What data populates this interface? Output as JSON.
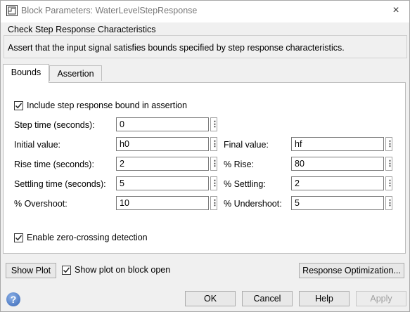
{
  "window": {
    "title": "Block Parameters: WaterLevelStepResponse"
  },
  "description": {
    "group_title": "Check Step Response Characteristics",
    "text": "Assert that the input signal satisfies bounds specified by step response characteristics."
  },
  "tabs": [
    {
      "label": "Bounds",
      "selected": true
    },
    {
      "label": "Assertion",
      "selected": false
    }
  ],
  "bounds": {
    "include_bound": {
      "label": "Include step response bound in assertion",
      "checked": true
    },
    "step_time": {
      "label": "Step time (seconds):",
      "value": "0"
    },
    "initial_value": {
      "label": "Initial value:",
      "value": "h0"
    },
    "final_value": {
      "label": "Final value:",
      "value": "hf"
    },
    "rise_time": {
      "label": "Rise time (seconds):",
      "value": "2"
    },
    "percent_rise": {
      "label": "% Rise:",
      "value": "80"
    },
    "settling_time": {
      "label": "Settling time (seconds):",
      "value": "5"
    },
    "percent_settling": {
      "label": "% Settling:",
      "value": "2"
    },
    "percent_overshoot": {
      "label": "% Overshoot:",
      "value": "10"
    },
    "percent_undershoot": {
      "label": "% Undershoot:",
      "value": "5"
    },
    "zero_crossing": {
      "label": "Enable zero-crossing detection",
      "checked": true
    },
    "dots_glyph": "⋮"
  },
  "plot": {
    "show_plot_label": "Show Plot",
    "show_on_open_label": "Show plot on block open",
    "show_on_open_checked": true,
    "response_optimization_label": "Response Optimization..."
  },
  "footer": {
    "help_glyph": "?",
    "ok_label": "OK",
    "cancel_label": "Cancel",
    "help_label": "Help",
    "apply_label": "Apply"
  },
  "icons": {
    "close": "×"
  },
  "colors": {
    "help_icon": "#3565b5",
    "disabled_text": "#a0a0a0"
  }
}
